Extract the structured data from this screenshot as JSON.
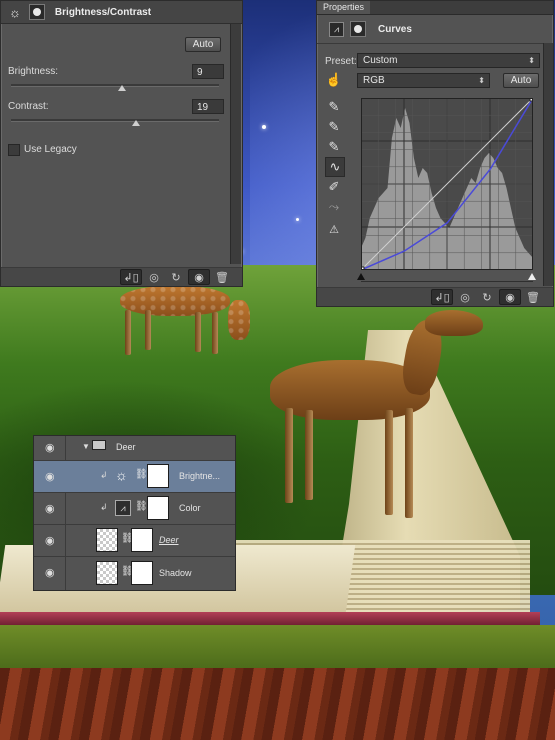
{
  "brightness_contrast_panel": {
    "title": "Brightness/Contrast",
    "auto_label": "Auto",
    "brightness_label": "Brightness:",
    "brightness_value": "9",
    "contrast_label": "Contrast:",
    "contrast_value": "19",
    "use_legacy_label": "Use Legacy"
  },
  "properties_panel": {
    "tab_label": "Properties",
    "adjustment_title": "Curves",
    "preset_label": "Preset:",
    "preset_value": "Custom",
    "channel_value": "RGB",
    "auto_label": "Auto"
  },
  "curves": {
    "type": "curve",
    "input_range": [
      0,
      255
    ],
    "output_range": [
      0,
      255
    ],
    "baseline": [
      [
        0,
        0
      ],
      [
        255,
        255
      ]
    ],
    "curve_points": [
      [
        0,
        0
      ],
      [
        64,
        28
      ],
      [
        128,
        70
      ],
      [
        192,
        150
      ],
      [
        255,
        255
      ]
    ],
    "curve_color": "#4a4ad8",
    "histogram_color": "#a8a8a8"
  },
  "layers_panel": {
    "group_name": "Deer",
    "layers": [
      {
        "name": "Brightne...",
        "selected": true
      },
      {
        "name": "Color",
        "selected": false
      },
      {
        "name": "Deer",
        "selected": false
      },
      {
        "name": "Shadow",
        "selected": false
      }
    ]
  },
  "icons": [
    "sun-adjust-icon",
    "mask-icon",
    "eye-icon",
    "chain-icon",
    "trash-icon",
    "reset-icon",
    "clip-icon",
    "curves-adjust-icon",
    "eyedropper-icon",
    "pencil-icon",
    "smooth-icon",
    "hand-icon",
    "warning-icon",
    "folder-icon"
  ]
}
